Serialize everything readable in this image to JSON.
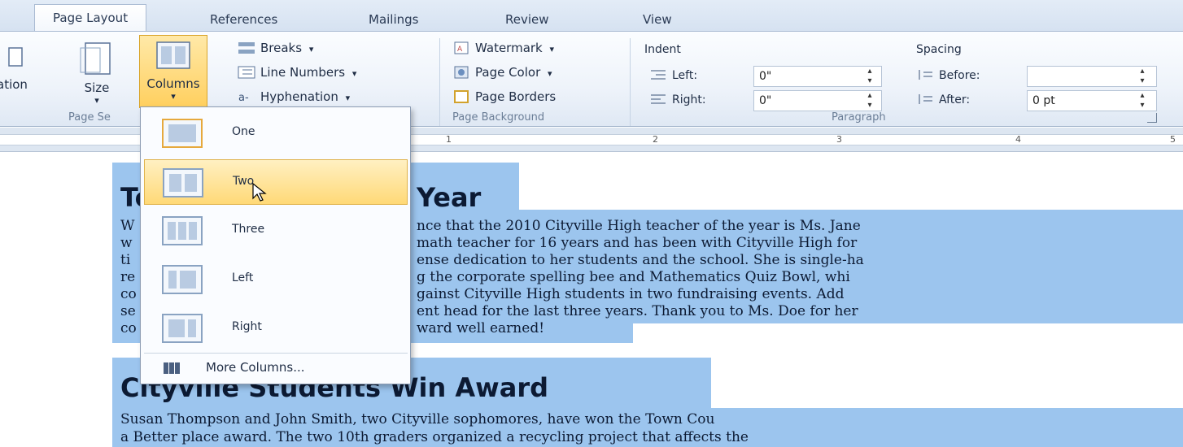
{
  "tabs": {
    "items": [
      "Page Layout",
      "References",
      "Mailings",
      "Review",
      "View"
    ],
    "active": "Page Layout"
  },
  "ribbon": {
    "page_setup": {
      "partial_label": "ation",
      "size_label": "Size",
      "columns_label": "Columns",
      "breaks": "Breaks",
      "line_numbers": "Line Numbers",
      "hyphenation": "Hyphenation",
      "group_label": "Page Se"
    },
    "page_background": {
      "watermark": "Watermark",
      "page_color": "Page Color",
      "page_borders": "Page Borders",
      "group_label": "Page Background"
    },
    "paragraph": {
      "indent_title": "Indent",
      "left_label": "Left:",
      "left_value": "0\"",
      "right_label": "Right:",
      "right_value": "0\"",
      "spacing_title": "Spacing",
      "before_label": "Before:",
      "before_value": "",
      "after_label": "After:",
      "after_value": "0 pt",
      "group_label": "Paragraph"
    },
    "dropdown_glyph": "▾"
  },
  "ruler": {
    "marks": [
      "1",
      "2",
      "3",
      "4",
      "5"
    ]
  },
  "columns_menu": {
    "items": [
      {
        "label": "One",
        "cols": 1
      },
      {
        "label": "Two",
        "cols": 2
      },
      {
        "label": "Three",
        "cols": 3
      },
      {
        "label": "Left",
        "cols": "left"
      },
      {
        "label": "Right",
        "cols": "right"
      }
    ],
    "hovered": "Two",
    "more_columns": "More Columns..."
  },
  "document": {
    "heading1_left": "Te",
    "heading1_right": "Year",
    "para1": [
      {
        "left": "W",
        "right": "nce that the 2010 Cityville High teacher of the year is Ms. Jane"
      },
      {
        "left": "w",
        "right": "math teacher for 16 years and has been with Cityville High for"
      },
      {
        "left": "ti",
        "right": "ense dedication to her students and the school. She is single-ha"
      },
      {
        "left": "re",
        "right": "g the corporate spelling bee and Mathematics Quiz Bowl, whi"
      },
      {
        "left": "co",
        "right": "gainst Cityville High students in two fundraising events. Add"
      },
      {
        "left": "se",
        "right": "ent head for the last three years. Thank you to Ms. Doe for her"
      },
      {
        "left": "co",
        "right": "ward well earned!"
      }
    ],
    "heading2": "Cityville Students Win Award",
    "para2": [
      "Susan Thompson and John Smith, two Cityville sophomores, have won the Town Cou",
      "a Better place award. The two 10th graders organized a recycling project that affects the"
    ]
  },
  "colors": {
    "selection": "#9cc5ee",
    "hover_gold": "#ffd977",
    "ribbon_bg": "#eef3fa",
    "text_dark": "#0c1a33"
  }
}
